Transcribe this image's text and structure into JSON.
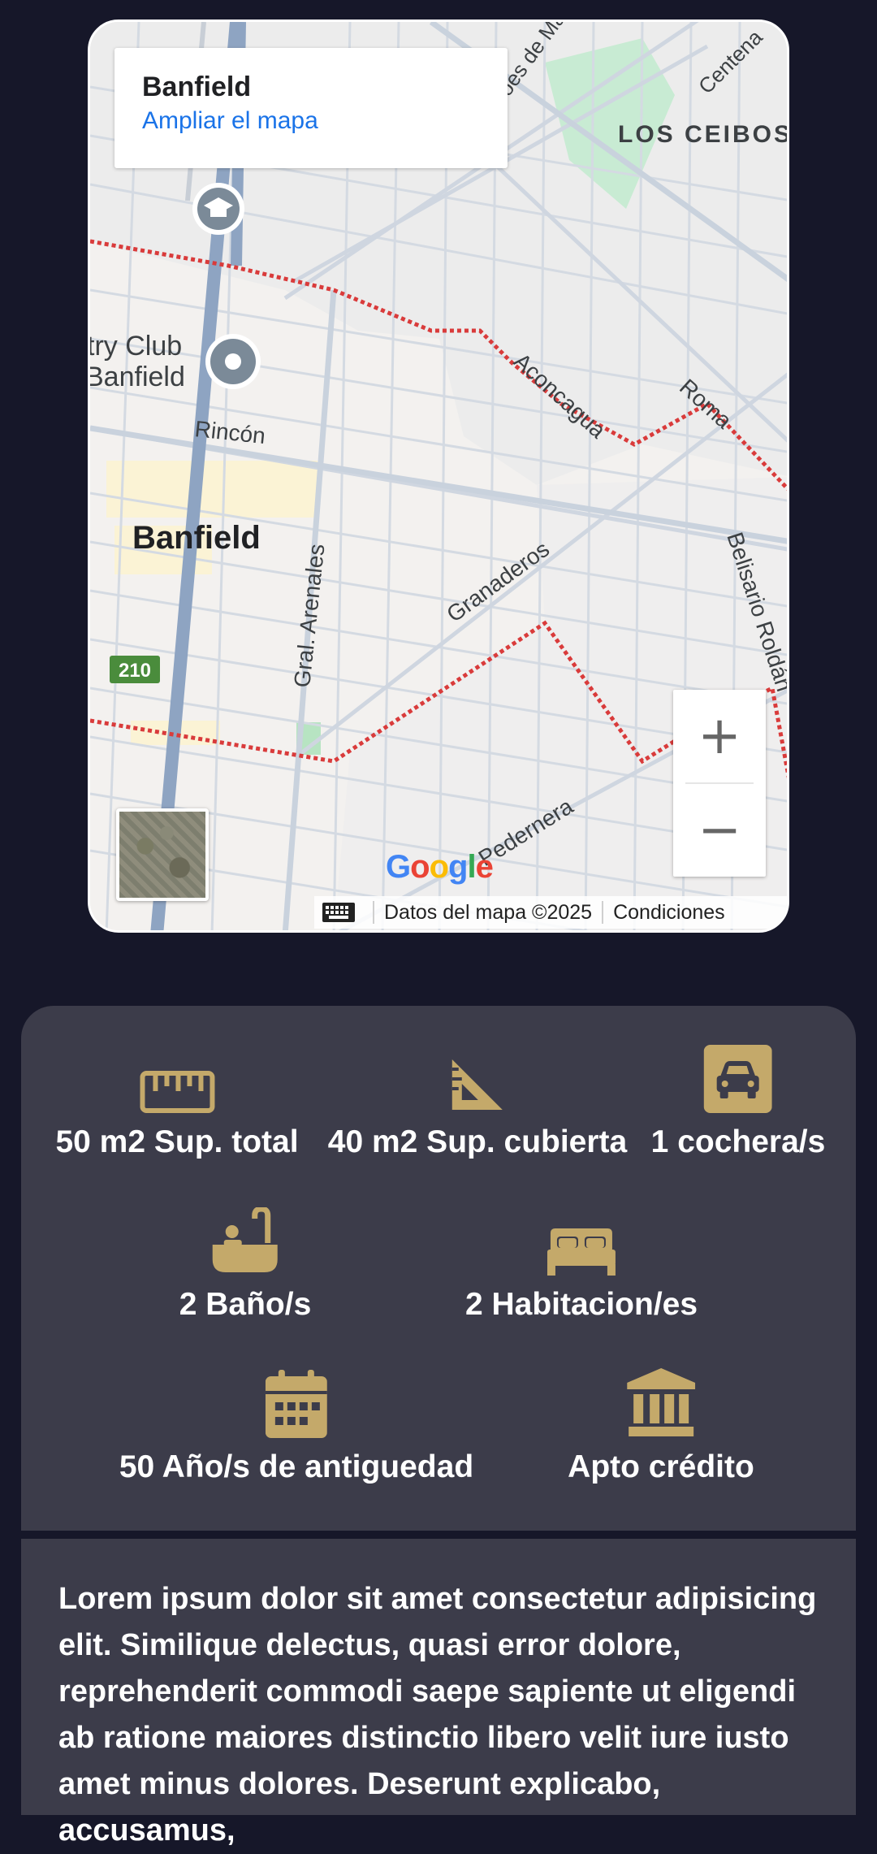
{
  "map": {
    "place_title": "Banfield",
    "enlarge_link": "Ampliar el mapa",
    "labels": {
      "los_ceibos": "LOS CEIBOS",
      "country_club": [
        "try Club",
        "Banfield"
      ],
      "rincon": "Rincón",
      "banfield": "Banfield",
      "gral_arenales": "Gral. Arenales",
      "granaderos": "Granaderos",
      "aconcagua": "Aconcagua",
      "roma": "Roma",
      "belisario": "Belisario Roldán",
      "pedernera": "Pedernera",
      "heroes": "roes de Ma",
      "centenario": "Centena",
      "route": "210"
    },
    "zoom_in": "+",
    "zoom_out": "−",
    "logo": [
      "G",
      "o",
      "o",
      "g",
      "l",
      "e"
    ],
    "logo_colors": [
      "#4285F4",
      "#EA4335",
      "#FBBC05",
      "#4285F4",
      "#34A853",
      "#EA4335"
    ],
    "attribution": "Datos del mapa ©2025",
    "terms": "Condiciones"
  },
  "features": [
    {
      "icon": "ruler-icon",
      "label": "50 m2 Sup. total"
    },
    {
      "icon": "set-square-icon",
      "label": "40 m2 Sup. cubierta"
    },
    {
      "icon": "car-icon",
      "label": "1 cochera/s"
    },
    {
      "icon": "bathtub-icon",
      "label": "2 Baño/s"
    },
    {
      "icon": "bed-icon",
      "label": "2 Habitacion/es"
    },
    {
      "icon": "calendar-icon",
      "label": "50 Año/s de antiguedad"
    },
    {
      "icon": "bank-icon",
      "label": "Apto crédito"
    }
  ],
  "description": "Lorem ipsum dolor sit amet consectetur adipisicing elit. Similique delectus, quasi error dolore, reprehenderit commodi saepe sapiente ut eligendi ab ratione maiores distinctio libero velit iure iusto amet minus dolores. Deserunt explicabo, accusamus,",
  "colors": {
    "background": "#161729",
    "panel": "#3c3c4a",
    "icon_gold": "#c4a96a",
    "text": "#ffffff"
  }
}
